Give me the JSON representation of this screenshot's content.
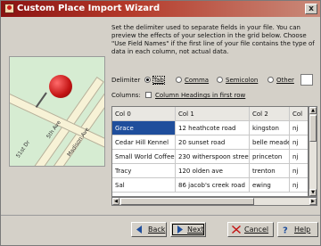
{
  "window": {
    "title": "Custom Place Import Wizard",
    "close_glyph": "x"
  },
  "description": "Set the delimiter used to separate fields in your file. You can preview the effects of your selection in the grid below. Choose \"Use Field Names\" if the first line of your file contains the type of data in each column, not actual data.",
  "map": {
    "road_labels": [
      "51st Dr",
      "5th Ave",
      "Madison Ave"
    ]
  },
  "delimiter": {
    "label": "Delimiter",
    "options": [
      "Tab",
      "Comma",
      "Semicolon",
      "Other"
    ],
    "selected": "Tab",
    "other_value": ""
  },
  "columns": {
    "label": "Columns:",
    "checkbox_label": "Column Headings in first row",
    "checked": false
  },
  "grid": {
    "headers": [
      "Col 0",
      "Col 1",
      "Col 2",
      "Col"
    ],
    "rows": [
      [
        "Grace",
        "12 heathcote road",
        "kingston",
        "nj"
      ],
      [
        "Cedar Hill Kennel",
        "20 sunset road",
        "belle meade",
        "nj"
      ],
      [
        "Small World Coffee",
        "230 witherspoon street",
        "princeton",
        "nj"
      ],
      [
        "Tracy",
        "120 olden ave",
        "trenton",
        "nj"
      ],
      [
        "Sal",
        "86 jacob's creek road",
        "ewing",
        "nj"
      ]
    ],
    "selected_row": 0
  },
  "buttons": {
    "back": "Back",
    "next": "Next",
    "cancel": "Cancel",
    "help": "Help"
  },
  "colors": {
    "title_bar": "#8a1212",
    "selection": "#1f4e9c",
    "pin": "#c31414"
  }
}
